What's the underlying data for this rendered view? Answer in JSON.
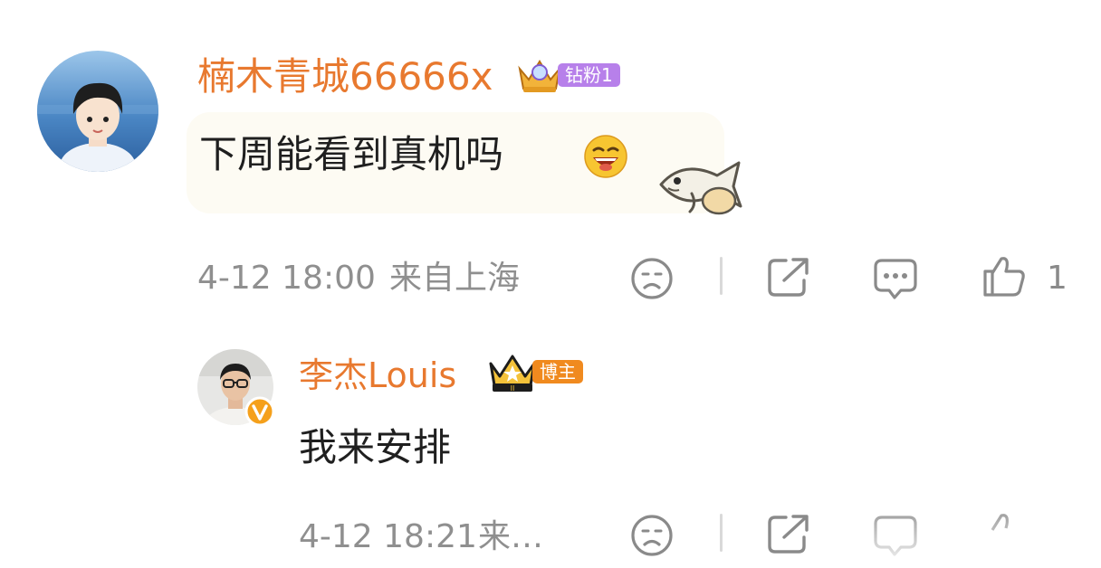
{
  "comment": {
    "username": "楠木青城66666x",
    "badge_label": "钻粉1",
    "text": "下周能看到真机吗",
    "emoji": "laughing-emoji",
    "sticker": "fish-sticker",
    "time": "4-12 18:00",
    "location": "来自上海",
    "like_count": "1"
  },
  "reply": {
    "username": "李杰Louis",
    "badge_label": "博主",
    "text": "我来安排",
    "time": "4-12 18:21",
    "location": "来…"
  },
  "colors": {
    "username": "#e8792f",
    "fan_badge": "#b780ea",
    "host_badge": "#f08a1f",
    "meta_text": "#8f8f8f",
    "icon": "#8a8a8a"
  }
}
